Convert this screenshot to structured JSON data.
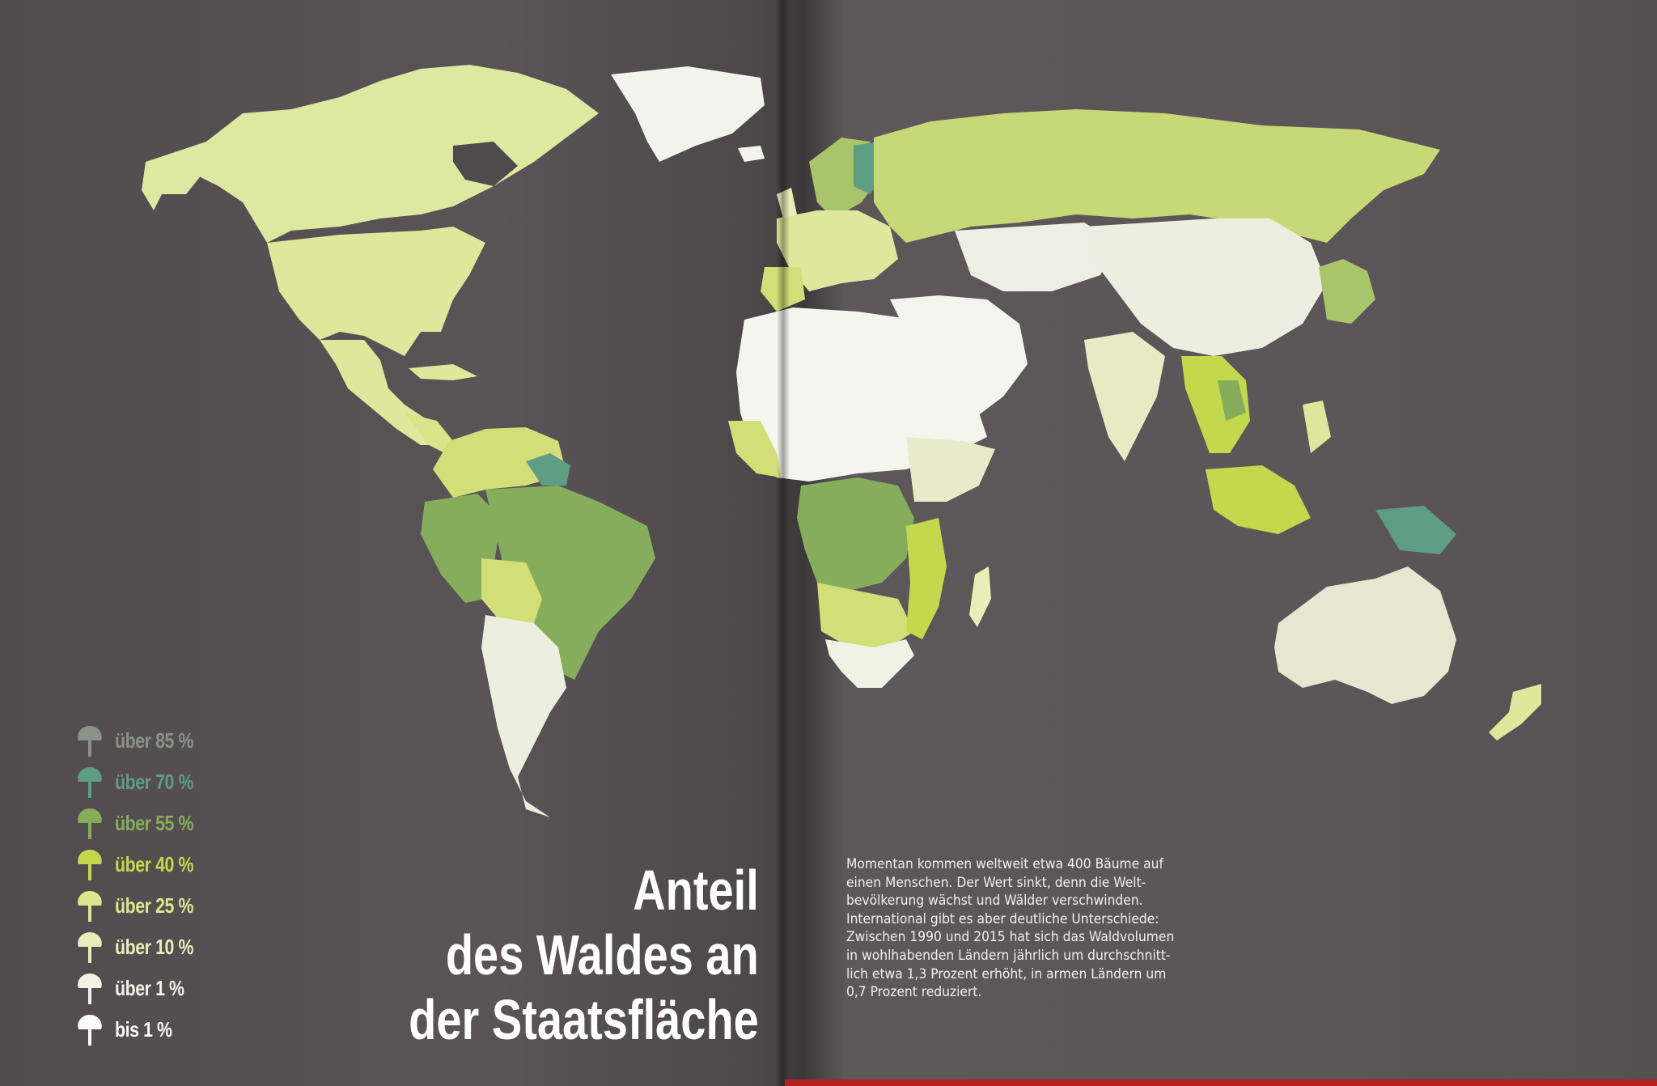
{
  "title_lines": [
    "Anteil",
    "des Waldes an",
    "der Staatsfläche"
  ],
  "legend": [
    {
      "label": "über 85 %",
      "color": "#8a938a",
      "icon": "tree-icon"
    },
    {
      "label": "über 70 %",
      "color": "#5f9c84",
      "icon": "tree-icon"
    },
    {
      "label": "über 55 %",
      "color": "#86ad5c",
      "icon": "tree-icon"
    },
    {
      "label": "über 40 %",
      "color": "#c4d84d",
      "icon": "tree-icon"
    },
    {
      "label": "über 25 %",
      "color": "#dfe58f",
      "icon": "tree-icon"
    },
    {
      "label": "über 10 %",
      "color": "#e9eeb9",
      "icon": "tree-icon"
    },
    {
      "label": "über 1 %",
      "color": "#f2f2e6",
      "icon": "tree-icon"
    },
    {
      "label": "bis 1 %",
      "color": "#fbfbf8",
      "icon": "tree-icon"
    }
  ],
  "body_text_lines": [
    "Momentan kommen weltweit etwa 400 Bäume auf",
    "einen Menschen. Der Wert sinkt, denn die Welt-",
    "bevölkerung wächst und Wälder verschwinden.",
    "International gibt es aber deutliche Unterschiede:",
    "Zwischen 1990 und 2015 hat sich das Waldvolumen",
    "in wohlhabenden Ländern jährlich um durchschnitt-",
    "lich etwa 1,3 Prozent erhöht, in armen Ländern um",
    "0,7 Prozent reduziert."
  ],
  "colors": {
    "background": "#565052",
    "accent_red": "#b3201f"
  }
}
